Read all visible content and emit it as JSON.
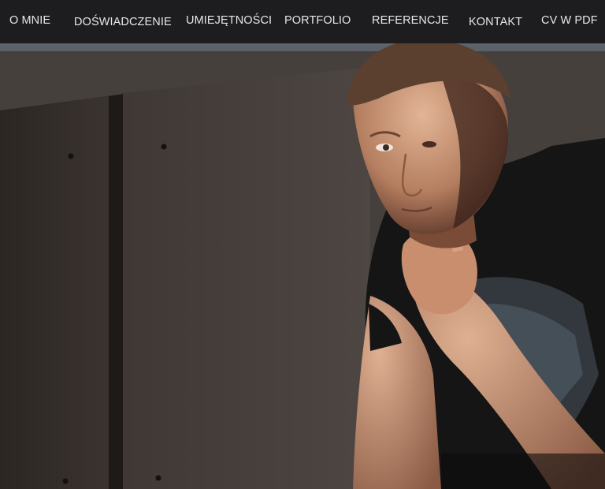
{
  "nav": {
    "items": [
      {
        "label": "O MNIE"
      },
      {
        "label": "DOŚWIADCZENIE"
      },
      {
        "label": "UMIEJĘTNOŚCI"
      },
      {
        "label": "PORTFOLIO"
      },
      {
        "label": "REFERENCJE"
      },
      {
        "label": "KONTAKT"
      },
      {
        "label": "CV W PDF"
      }
    ]
  },
  "colors": {
    "navbar_bg": "#1d1d1f",
    "nav_text": "#e8e8e8",
    "background_panels": "#3a3431"
  },
  "hero": {
    "image_subject": "portrait-photo"
  }
}
